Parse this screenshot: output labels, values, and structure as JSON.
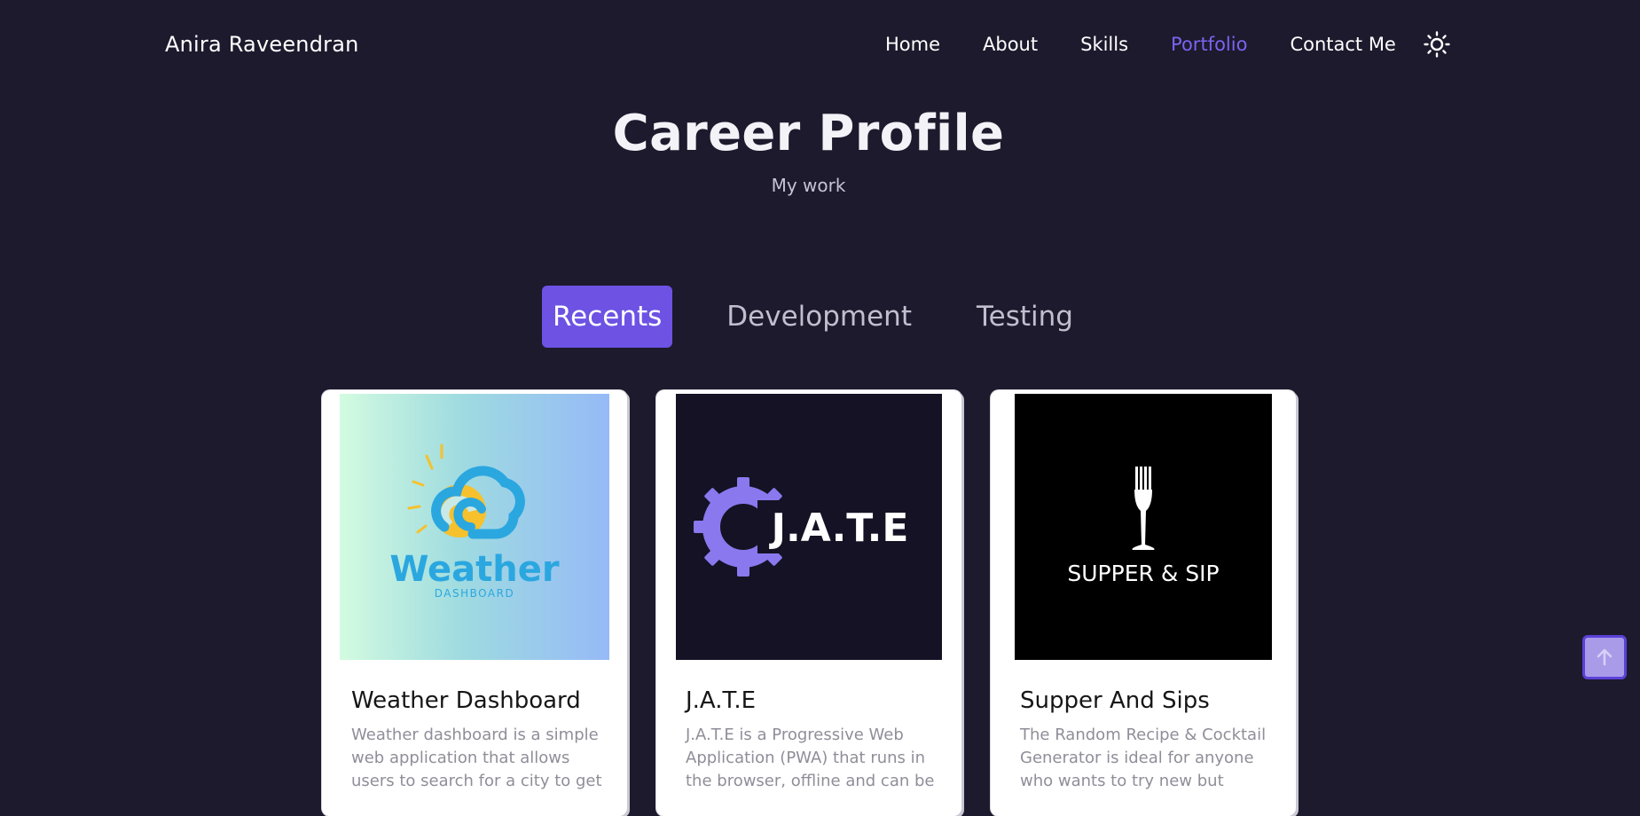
{
  "header": {
    "brand": "Anira Raveendran",
    "nav": [
      {
        "label": "Home"
      },
      {
        "label": "About"
      },
      {
        "label": "Skills"
      },
      {
        "label": "Portfolio",
        "active": true
      },
      {
        "label": "Contact Me"
      }
    ],
    "theme_toggle_icon": "sun-icon"
  },
  "hero": {
    "title": "Career Profile",
    "subtitle": "My work"
  },
  "tabs": [
    {
      "label": "Recents",
      "active": true
    },
    {
      "label": "Development"
    },
    {
      "label": "Testing"
    }
  ],
  "projects": [
    {
      "title": "Weather Dashboard",
      "description": "Weather dashboard is a simple web application that allows users to search for a city to get",
      "logo_text": "Weather",
      "logo_subtext": "DASHBOARD"
    },
    {
      "title": "J.A.T.E",
      "description": "J.A.T.E is a Progressive Web Application (PWA) that runs in the browser, offline and can be",
      "logo_text": "J.A.T.E"
    },
    {
      "title": "Supper And Sips",
      "description": "The Random Recipe & Cocktail Generator is ideal for anyone who wants to try new but",
      "logo_text": "SUPPER & SIP"
    }
  ],
  "colors": {
    "background": "#1c1a2c",
    "accent": "#6d52e4",
    "nav_active": "#7c63f0"
  },
  "scroll_top_icon": "arrow-up-icon"
}
